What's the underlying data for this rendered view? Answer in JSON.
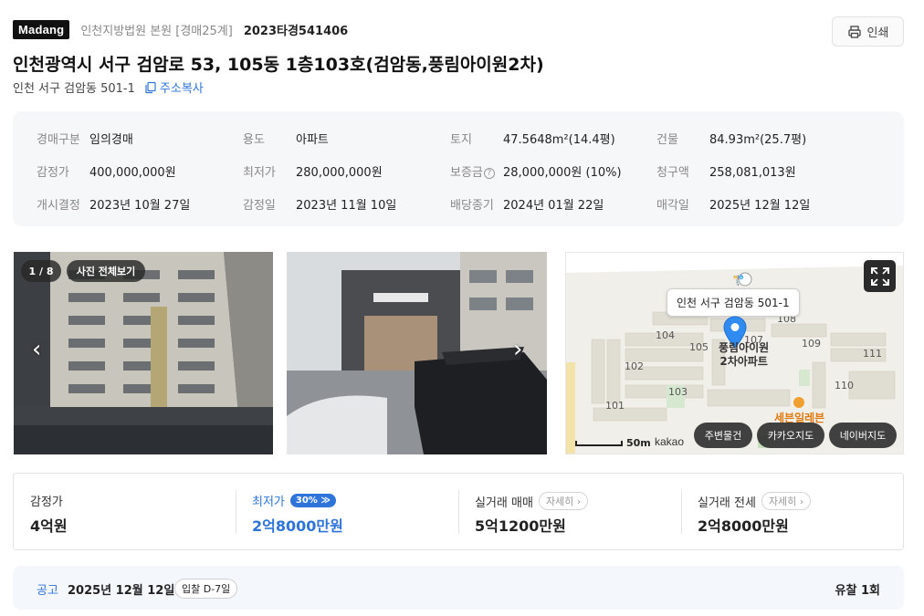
{
  "header": {
    "brand": "Madang",
    "court": "인천지방법원 본원 [경매25계]",
    "case_number": "2023타경541406",
    "print_label": "인쇄"
  },
  "title": "인천광역시 서구 검암로 53, 105동 1층103호(검암동,풍림아이원2차)",
  "sub_address": "인천 서구 검암동 501-1",
  "copy_address_label": "주소복사",
  "info": {
    "auction_type_label": "경매구분",
    "auction_type": "임의경매",
    "usage_label": "용도",
    "usage": "아파트",
    "land_label": "토지",
    "land": "47.5648m²(14.4평)",
    "building_label": "건물",
    "building": "84.93m²(25.7평)",
    "appraisal_label": "감정가",
    "appraisal": "400,000,000원",
    "min_price_label": "최저가",
    "min_price": "280,000,000원",
    "deposit_label": "보증금",
    "deposit": "28,000,000원 (10%)",
    "claim_label": "청구액",
    "claim": "258,081,013원",
    "start_label": "개시결정",
    "start_date": "2023년 10월 27일",
    "appraisal_date_label": "감정일",
    "appraisal_date": "2023년 11월 10일",
    "dividend_label": "배당종기",
    "dividend_date": "2024년 01월 22일",
    "sale_label": "매각일",
    "sale_date": "2025년 12월 12일"
  },
  "photos": {
    "counter": "1 / 8",
    "view_all_label": "사진 전체보기"
  },
  "map": {
    "callout": "인천 서구 검암동 501-1",
    "poi_line1": "풍림아이원",
    "poi_line2": "2차아파트",
    "buildings": [
      "108",
      "107",
      "104",
      "105",
      "109",
      "111",
      "102",
      "103",
      "101",
      "110"
    ],
    "store": "세븐일레븐",
    "scale": "50m",
    "provider": "kakao",
    "chip_nearby": "주변물건",
    "chip_kakao": "카카오지도",
    "chip_naver": "네이버지도"
  },
  "prices": {
    "appraisal_label": "감정가",
    "appraisal_value": "4억원",
    "min_label": "최저가",
    "min_pct": "30%",
    "min_value": "2억8000만원",
    "trade_label": "실거래 매매",
    "trade_detail": "자세히",
    "trade_value": "5억1200만원",
    "jeonse_label": "실거래 전세",
    "jeonse_detail": "자세히",
    "jeonse_value": "2억8000만원"
  },
  "notice": {
    "label": "공고",
    "date": "2025년 12월 12일",
    "dday": "입찰 D-7일",
    "fail_count": "유찰 1회"
  },
  "colors": {
    "accent": "#2f74d8",
    "brand_bg": "#111111",
    "panel_bg": "#f6f7f9"
  }
}
